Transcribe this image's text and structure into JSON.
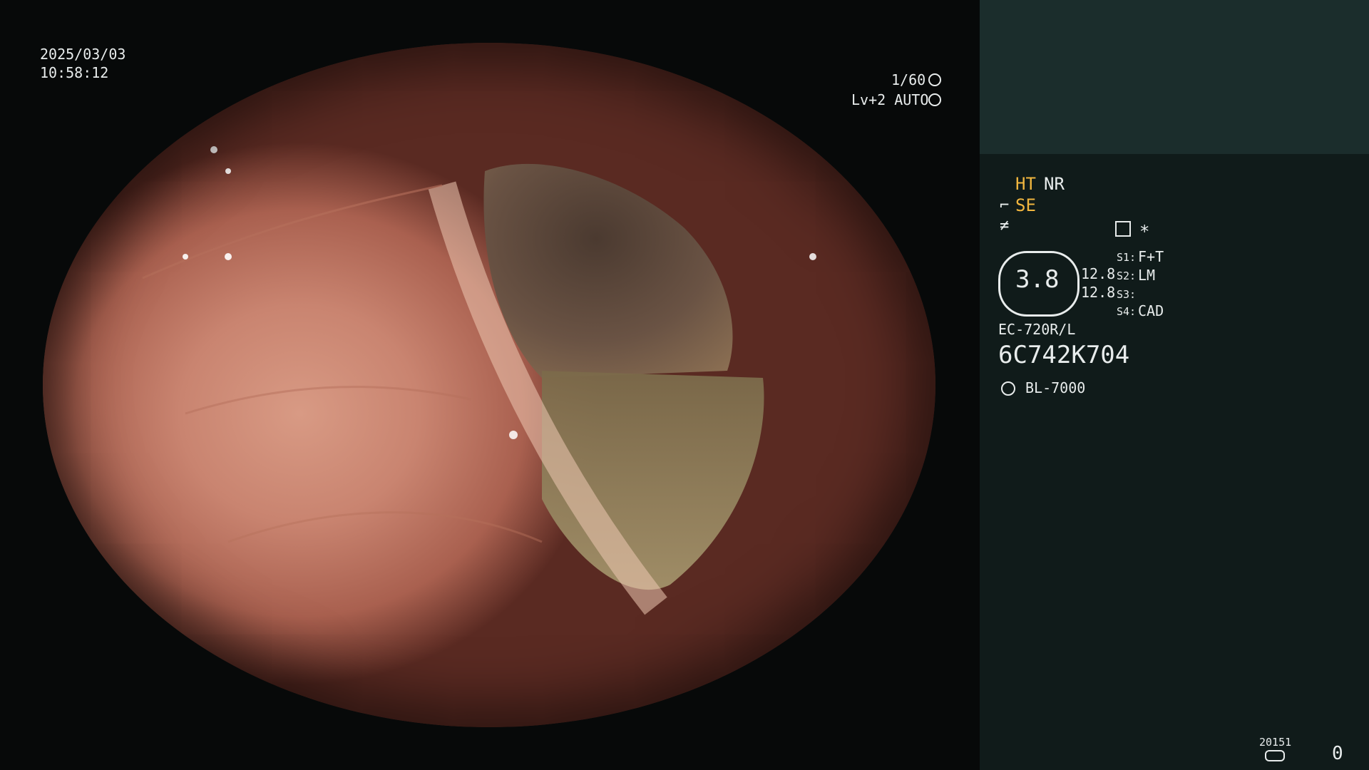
{
  "overlay": {
    "date": "2025/03/03",
    "time": "10:58:12",
    "shutter": "1/60",
    "level": "Lv+2 AUTO"
  },
  "panel": {
    "ht": "HT",
    "nr": "NR",
    "se": "SE",
    "star": "∗",
    "gauge_value": "3.8",
    "gauge_side_1": "12.8",
    "gauge_side_2": "12.8",
    "s1_key": "S1:",
    "s1_val": "F+T",
    "s2_key": "S2:",
    "s2_val": "LM",
    "s3_key": "S3:",
    "s3_val": "",
    "s4_key": "S4:",
    "s4_val": "CAD",
    "model": "EC-720R/L",
    "serial": "6C742K704",
    "light": "BL-7000",
    "counter_small": "20151",
    "counter": "0"
  },
  "colors": {
    "accent": "#f1b63f",
    "panel_bg": "#101b1a",
    "panel_top": "#1b2d2c"
  }
}
